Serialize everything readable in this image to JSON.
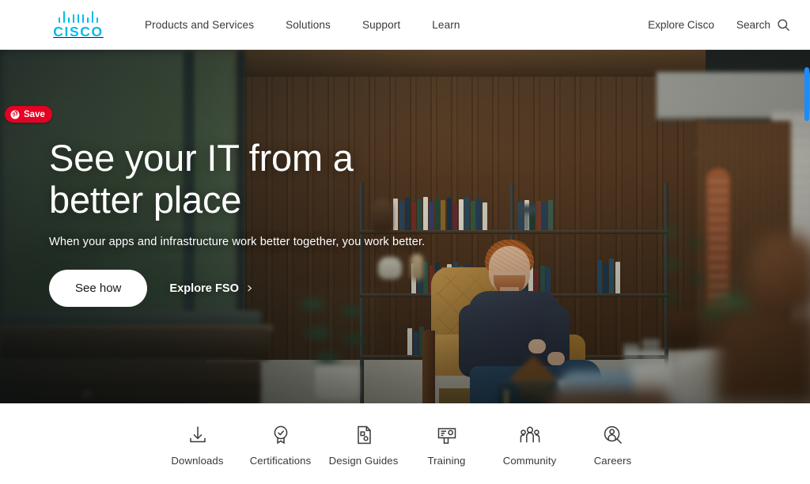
{
  "header": {
    "logo": {
      "name": "cisco-logo",
      "wordmark": "CISCO",
      "color": "#00bceb"
    },
    "nav": [
      {
        "label": "Products and Services"
      },
      {
        "label": "Solutions"
      },
      {
        "label": "Support"
      },
      {
        "label": "Learn"
      }
    ],
    "explore_label": "Explore Cisco",
    "search_label": "Search",
    "search_icon": "search-icon"
  },
  "hero": {
    "headline": "See your IT from a better place",
    "subhead": "When your apps and infrastructure work better together, you work better.",
    "primary_cta": "See how",
    "secondary_cta": "Explore FSO",
    "secondary_cta_icon": "chevron-right-icon",
    "image_alt": "Man seated in tan leather armchair in a mid-century modern living room with bookshelf, wood paneling and plants"
  },
  "pin_save": {
    "label": "Save",
    "icon": "pinterest-icon",
    "color": "#e60023"
  },
  "quicklinks": [
    {
      "label": "Downloads",
      "icon": "download-icon"
    },
    {
      "label": "Certifications",
      "icon": "award-badge-icon"
    },
    {
      "label": "Design Guides",
      "icon": "document-icon"
    },
    {
      "label": "Training",
      "icon": "presentation-board-icon"
    },
    {
      "label": "Community",
      "icon": "people-group-icon"
    },
    {
      "label": "Careers",
      "icon": "person-search-icon"
    }
  ],
  "scrollbar": {
    "thumb_color": "#1a8cff"
  }
}
